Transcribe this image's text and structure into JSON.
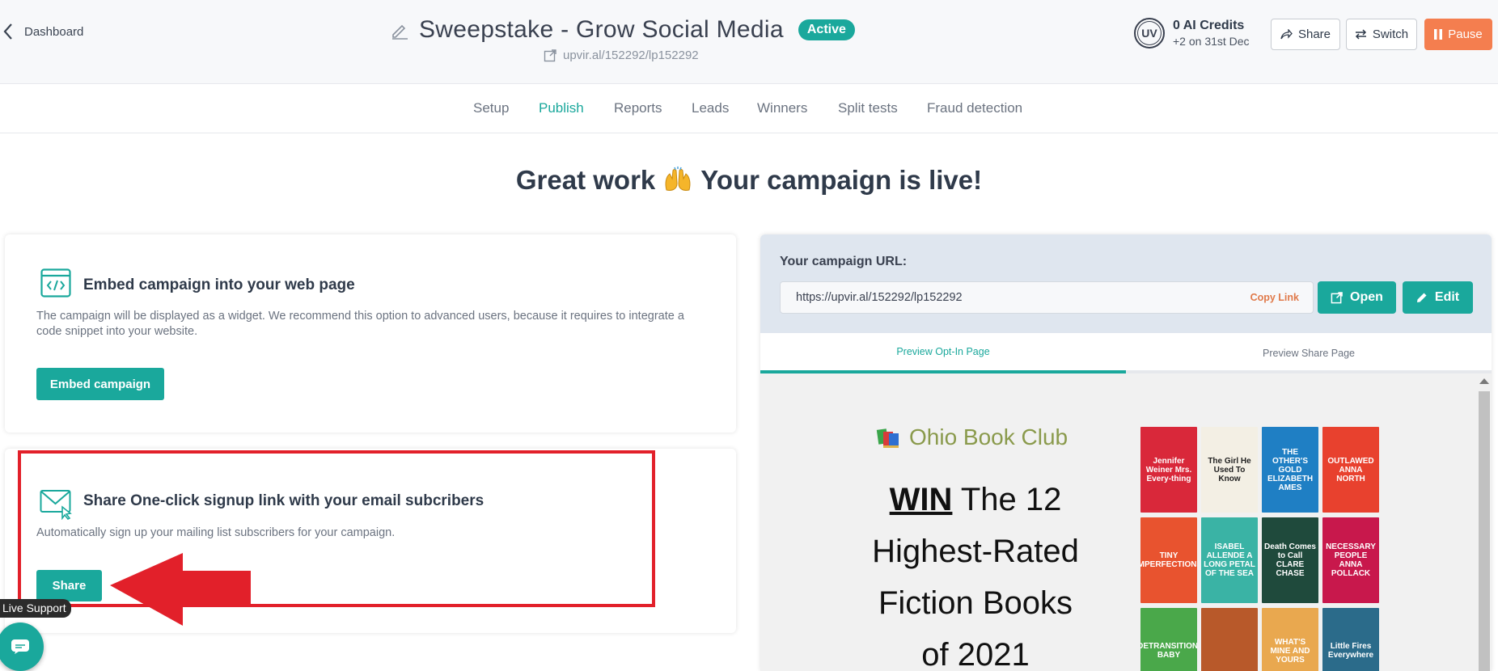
{
  "header": {
    "back_label": "Dashboard",
    "title": "Sweepstake - Grow Social Media",
    "status_badge": "Active",
    "subtitle_url": "upvir.al/152292/lp152292",
    "avatar_initials": "UV",
    "credits_title": "0 AI Credits",
    "credits_note": "+2 on 31st Dec",
    "share_label": "Share",
    "switch_label": "Switch",
    "pause_label": "Pause"
  },
  "tabs": [
    "Setup",
    "Publish",
    "Reports",
    "Leads",
    "Winners",
    "Split tests",
    "Fraud detection"
  ],
  "active_tab": "Publish",
  "hero": {
    "before": "Great work",
    "after": "Your campaign is live!",
    "emoji_icon": "raising-hands-icon"
  },
  "embed_card": {
    "title": "Embed campaign into your web page",
    "description_line1": "The campaign will be displayed as a widget. We recommend this option to advanced users, because it requires to integrate a",
    "description_line2": "code snippet into your website.",
    "button": "Embed campaign"
  },
  "share_card": {
    "title": "Share One-click signup link with your email subcribers",
    "description": "Automatically sign up your mailing list subscribers for your campaign.",
    "button": "Share"
  },
  "live_support": "Live Support",
  "campaign_url": {
    "label": "Your campaign URL:",
    "url": "https://upvir.al/152292/lp152292",
    "copy_label": "Copy Link",
    "open_label": "Open",
    "edit_label": "Edit"
  },
  "preview_tabs": {
    "optin": "Preview Opt-In Page",
    "share": "Preview Share Page"
  },
  "preview": {
    "club_name": "Ohio Book Club",
    "win_word": "WIN",
    "line1_rest": "The 12",
    "line2": "Highest-Rated",
    "line3": "Fiction Books",
    "line4": "of 2021",
    "books": [
      {
        "text": "Jennifer Weiner Mrs. Every-thing",
        "color": "#d9283a"
      },
      {
        "text": "The Girl He Used To Know",
        "color": "#f3efe4",
        "ink": "#222"
      },
      {
        "text": "THE OTHER'S GOLD ELIZABETH AMES",
        "color": "#1f7fc4"
      },
      {
        "text": "OUTLAWED ANNA NORTH",
        "color": "#e8412e"
      },
      {
        "text": "TINY IMPERFECTIONS",
        "color": "#e8532f"
      },
      {
        "text": "ISABEL ALLENDE A LONG PETAL OF THE SEA",
        "color": "#3ab3a5"
      },
      {
        "text": "Death Comes to Call CLARE CHASE",
        "color": "#1f4a3c"
      },
      {
        "text": "NECESSARY PEOPLE ANNA POLLACK",
        "color": "#c8184c"
      },
      {
        "text": "DETRANSITION, BABY",
        "color": "#4aa84a"
      },
      {
        "text": "",
        "color": "#b8592a"
      },
      {
        "text": "WHAT'S MINE AND YOURS",
        "color": "#e9a84f"
      },
      {
        "text": "Little Fires Everywhere",
        "color": "#2b6b8a"
      }
    ]
  },
  "colors": {
    "accent": "#1aa89c",
    "pause": "#f47e4f",
    "highlight": "#e2202a",
    "copy_link": "#e07a4a"
  }
}
